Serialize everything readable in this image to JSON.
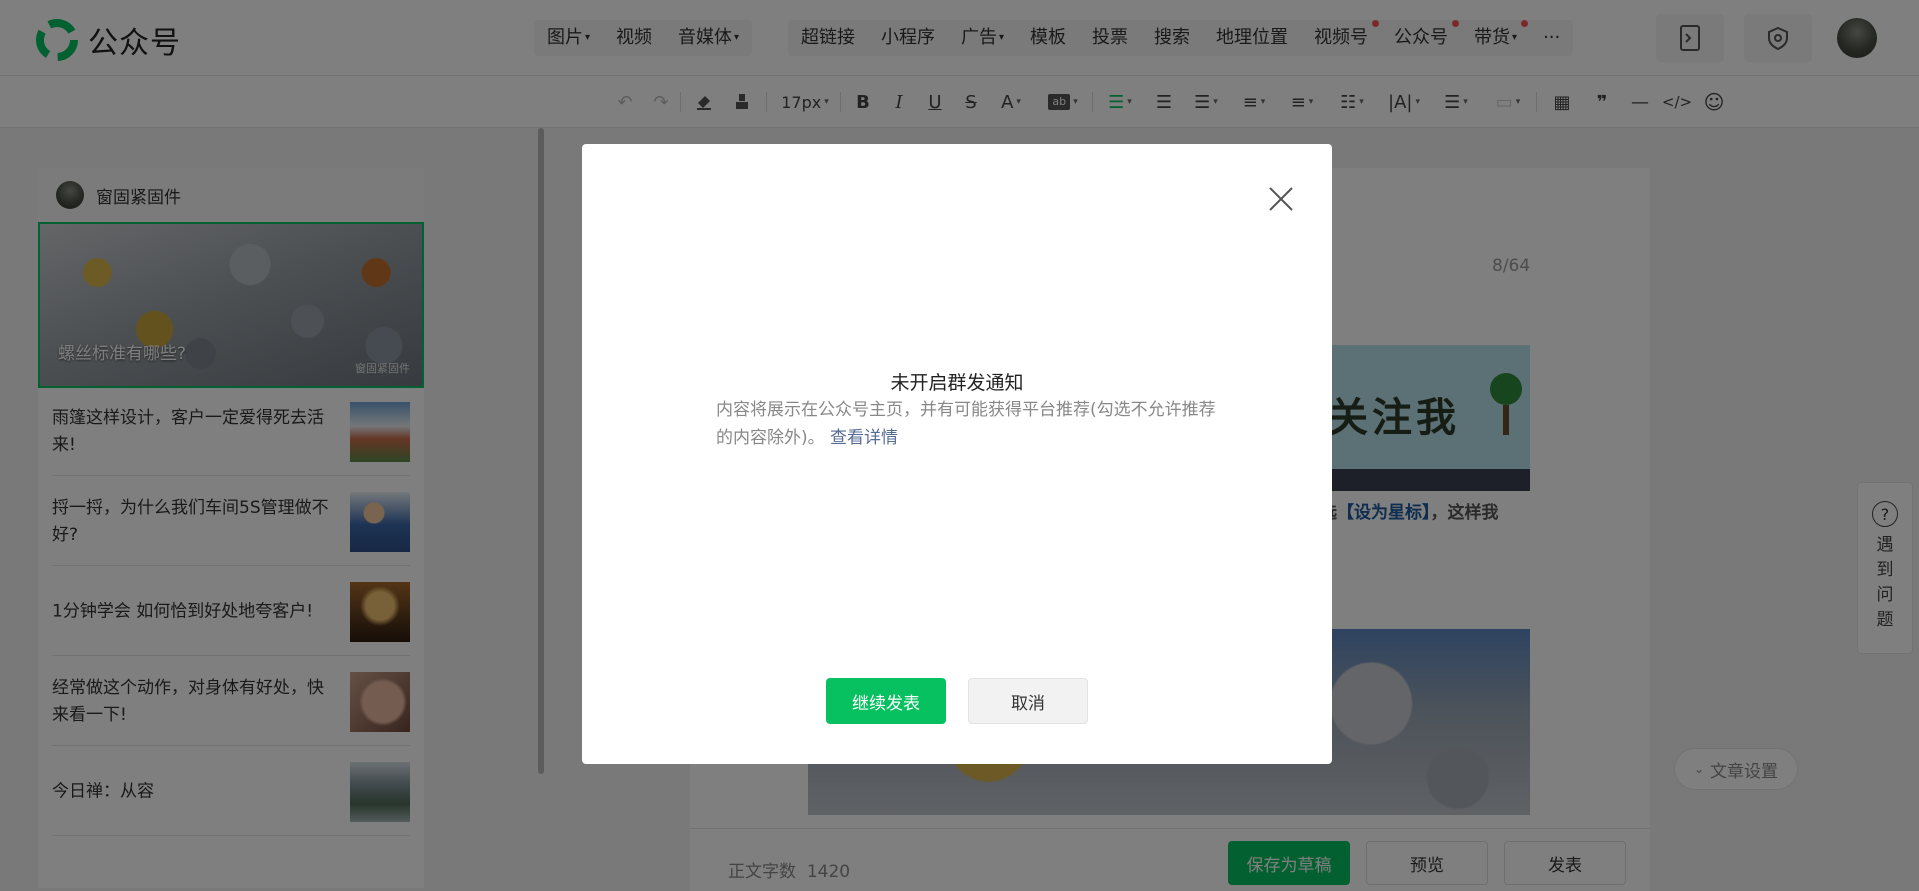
{
  "app": {
    "name": "公众号"
  },
  "nav": {
    "group1": [
      {
        "label": "图片",
        "dropdown": true
      },
      {
        "label": "视频",
        "dropdown": false
      },
      {
        "label": "音媒体",
        "dropdown": true
      }
    ],
    "group2": [
      {
        "label": "超链接",
        "dropdown": false,
        "dot": false
      },
      {
        "label": "小程序",
        "dropdown": false,
        "dot": false
      },
      {
        "label": "广告",
        "dropdown": true,
        "dot": false
      },
      {
        "label": "模板",
        "dropdown": false,
        "dot": false
      },
      {
        "label": "投票",
        "dropdown": false,
        "dot": false
      },
      {
        "label": "搜索",
        "dropdown": false,
        "dot": false
      },
      {
        "label": "地理位置",
        "dropdown": false,
        "dot": false
      },
      {
        "label": "视频号",
        "dropdown": false,
        "dot": true
      },
      {
        "label": "公众号",
        "dropdown": false,
        "dot": true
      },
      {
        "label": "带货",
        "dropdown": true,
        "dot": true
      },
      {
        "label": "···",
        "dropdown": false,
        "dot": false
      }
    ]
  },
  "toolbar": {
    "font_size": "17px"
  },
  "left_panel": {
    "account_name": "窗固紧固件",
    "cover_title": "螺丝标准有哪些?",
    "cover_watermark": "窗固紧固件",
    "articles": [
      {
        "title": "雨篷这样设计，客户一定爱得死去活来!"
      },
      {
        "title": "捋一捋，为什么我们车间5S管理做不好?"
      },
      {
        "title": "1分钟学会 如何恰到好处地夸客户!"
      },
      {
        "title": "经常做这个动作，对身体有好处，快来看一下!"
      },
      {
        "title": "今日禅：从容"
      }
    ]
  },
  "editor": {
    "title_counter": "8/64",
    "banner_text": "关注我",
    "line_prefix": "选",
    "line_highlight": "【设为星标】",
    "line_suffix": "，这样我"
  },
  "article_settings": {
    "label": "文章设置"
  },
  "bottom_bar": {
    "word_count_label": "正文字数",
    "word_count": "1420",
    "save_draft": "保存为草稿",
    "preview": "预览",
    "publish": "发表"
  },
  "help": {
    "label": "遇到问题"
  },
  "dialog": {
    "title": "未开启群发通知",
    "body": "内容将展示在公众号主页，并有可能获得平台推荐(勾选不允许推荐的内容除外)。",
    "link": "查看详情",
    "confirm": "继续发表",
    "cancel": "取消"
  },
  "colors": {
    "accent": "#07c160",
    "link": "#576b95",
    "badge": "#fa5151"
  }
}
